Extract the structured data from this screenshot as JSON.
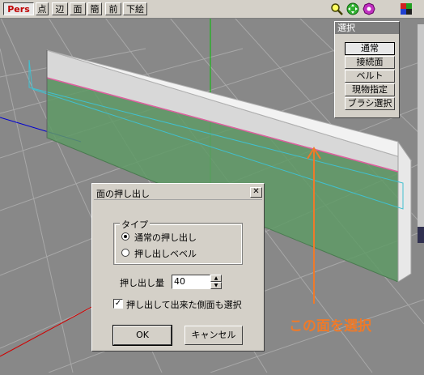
{
  "toolbar": {
    "view_mode": "Pers",
    "modes": [
      "点",
      "辺",
      "面",
      "簡",
      "前",
      "下絵"
    ],
    "icons": [
      "magnify-icon",
      "move-icon",
      "rotate-icon",
      "color-grid-icon"
    ]
  },
  "select_panel": {
    "title": "選択",
    "items": [
      "通常",
      "接続面",
      "ベルト",
      "現物指定",
      "ブラシ選択"
    ],
    "active": "通常"
  },
  "dialog": {
    "title": "面の押し出し",
    "close_glyph": "✕",
    "type_group_label": "タイプ",
    "options": [
      "通常の押し出し",
      "押し出しベベル"
    ],
    "selected_option": "通常の押し出し",
    "amount_label": "押し出し量",
    "amount_value": "40",
    "checkbox_label": "押し出して出来た側面も選択",
    "checkbox_checked": true,
    "ok_label": "OK",
    "cancel_label": "キャンセル"
  },
  "annotation": {
    "text": "この面を選択",
    "color": "#ee7a2a"
  },
  "colors": {
    "viewport_bg": "#888888",
    "face_green": "#5f9a66",
    "grid": "#a8a8a8",
    "axis_green": "#00c000",
    "axis_red": "#d00000",
    "axis_blue": "#0000d0",
    "selection_cyan": "#40c0d0"
  }
}
